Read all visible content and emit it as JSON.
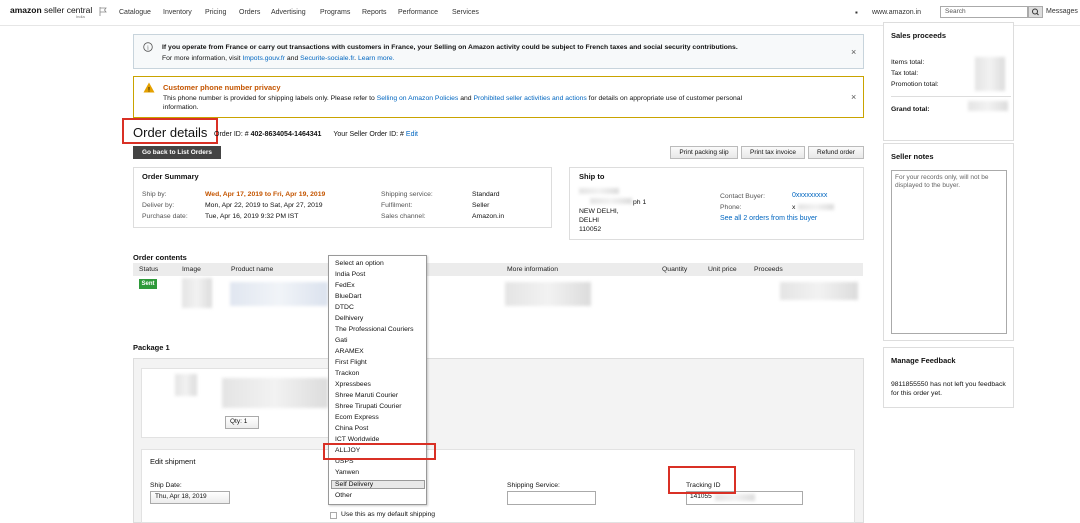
{
  "nav": {
    "logo_brand": "amazon",
    "logo_product": "seller central",
    "logo_region": "India",
    "items": [
      "Catalogue",
      "Inventory",
      "Pricing",
      "Orders",
      "Advertising",
      "Programs",
      "Reports",
      "Performance",
      "Services"
    ],
    "marketplace": "www.amazon.in",
    "search_placeholder": "Search",
    "messages": "Messages"
  },
  "alerts": {
    "france": {
      "line1": "If you operate from France or carry out transactions with customers in France, your Selling on Amazon activity could be subject to French taxes and social security contributions.",
      "line2_prefix": "For more information, visit ",
      "link1": "Impots.gouv.fr",
      "and": " and ",
      "link2": "Securite-sociale.fr",
      "learn_more": "Learn more."
    },
    "phone": {
      "title": "Customer phone number privacy",
      "body_prefix": "This phone number is provided for shipping labels only. Please refer to ",
      "link1": "Selling on Amazon Policies",
      "and": " and ",
      "link2": "Prohibited seller activities and actions",
      "body_suffix": " for details on appropriate use of customer personal",
      "body_line2": "information."
    },
    "close": "×"
  },
  "order": {
    "title": "Order details",
    "order_id_label": "Order ID: #",
    "order_id": "402-8634054-1464341",
    "seller_order_label": "Your Seller Order ID: #",
    "edit": "Edit",
    "back_button": "Go back to List Orders",
    "print_packing": "Print packing slip",
    "print_tax": "Print tax invoice",
    "refund": "Refund order"
  },
  "summary": {
    "title": "Order Summary",
    "ship_by_label": "Ship by:",
    "ship_by": "Wed, Apr 17, 2019 to Fri, Apr 19, 2019",
    "deliver_by_label": "Deliver by:",
    "deliver_by": "Mon, Apr 22, 2019 to Sat, Apr 27, 2019",
    "purchase_label": "Purchase date:",
    "purchase": "Tue, Apr 16, 2019 9:32 PM IST",
    "shipping_service_label": "Shipping service:",
    "shipping_service": "Standard",
    "fulfilment_label": "Fulfilment:",
    "fulfilment": "Seller",
    "sales_channel_label": "Sales channel:",
    "sales_channel": "Amazon.in"
  },
  "ship_to": {
    "title": "Ship to",
    "line1": "ph 1",
    "line2": "NEW DELHI,",
    "line3": "DELHI",
    "line4": "110052",
    "contact_label": "Contact Buyer:",
    "contact_value": "0xxxxxxxxx",
    "phone_label": "Phone:",
    "phone_value": "x",
    "see_all": "See all 2 orders from this buyer"
  },
  "contents": {
    "title": "Order contents",
    "headers": [
      "Status",
      "Image",
      "Product name",
      "More information",
      "Quantity",
      "Unit price",
      "Proceeds"
    ],
    "status": "Sent"
  },
  "package": {
    "title": "Package 1",
    "qty": "Qty: 1",
    "edit_title": "Edit shipment",
    "ship_date_label": "Ship Date:",
    "ship_date": "Thu, Apr 18, 2019",
    "shipping_service_label": "Shipping Service:",
    "tracking_label": "Tracking ID",
    "tracking_value": "141055",
    "default_checkbox": "Use this as my default shipping"
  },
  "dropdown": {
    "options": [
      "Select an option",
      "India Post",
      "FedEx",
      "BlueDart",
      "DTDC",
      "Delhivery",
      "The Professional Couriers",
      "Gati",
      "ARAMEX",
      "First Flight",
      "Trackon",
      "Xpressbees",
      "Shree Maruti Courier",
      "Shree Tirupati Courier",
      "Ecom Express",
      "China Post",
      "ICT Worldwide",
      "ALLJOY",
      "USPS",
      "Yanwen",
      "Self Delivery",
      "Other"
    ],
    "highlighted": "Self Delivery",
    "boxed": "ALLJOY"
  },
  "sidebar": {
    "proceeds_title": "Sales proceeds",
    "items_total": "Items total:",
    "tax_total": "Tax total:",
    "promotion_total": "Promotion total:",
    "grand_total": "Grand total:",
    "notes_title": "Seller notes",
    "notes_placeholder": "For your records only, will not be displayed to the buyer.",
    "feedback_title": "Manage Feedback",
    "feedback_text": "9811855550 has not left you feedback for this order yet."
  },
  "colors": {
    "accent_red": "#d93025",
    "link_blue": "#0066c0",
    "ship_by_orange": "#c45500",
    "sent_green": "#2e9a3a"
  }
}
